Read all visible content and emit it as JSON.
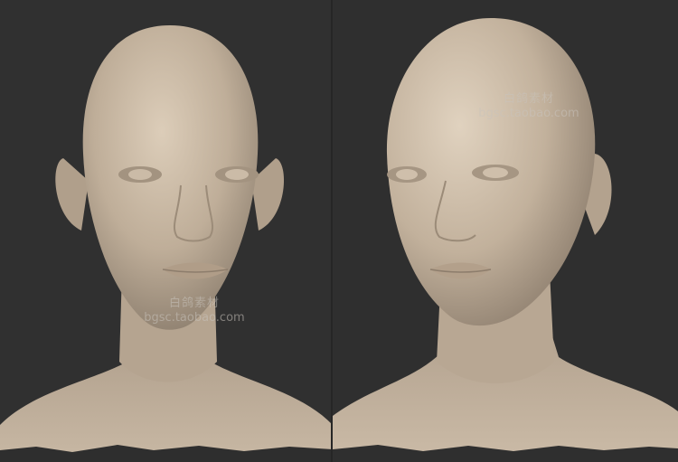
{
  "colors": {
    "background": "#2e2e2e",
    "skin_light": "#d8c8b4",
    "skin_mid": "#b9a894",
    "skin_shadow": "#8a7c6c"
  },
  "watermarks": [
    {
      "brand": "白鸽素材",
      "url": "bgsc.taobao.com"
    },
    {
      "brand": "白鸽素材",
      "url": "bgsc.taobao.com"
    }
  ],
  "subjects": [
    {
      "view": "front"
    },
    {
      "view": "three-quarter"
    }
  ]
}
